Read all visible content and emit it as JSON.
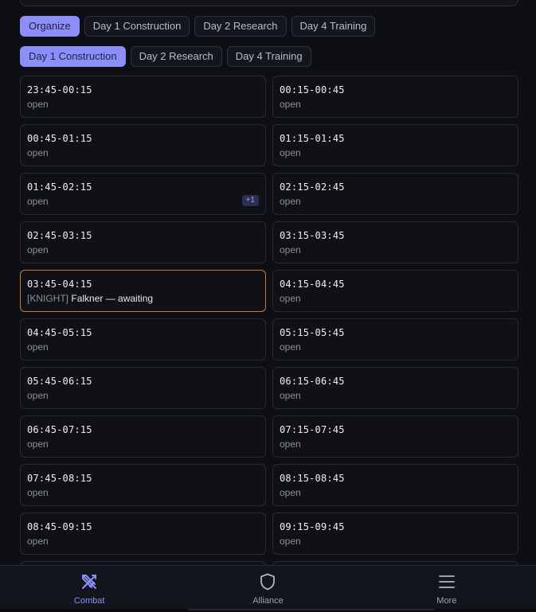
{
  "tabs_row1": [
    {
      "label": "Organize",
      "active": true
    },
    {
      "label": "Day 1 Construction",
      "active": false
    },
    {
      "label": "Day 2 Research",
      "active": false
    },
    {
      "label": "Day 4 Training",
      "active": false
    }
  ],
  "tabs_row2": [
    {
      "label": "Day 1 Construction",
      "active": true
    },
    {
      "label": "Day 2 Research",
      "active": false
    },
    {
      "label": "Day 4 Training",
      "active": false
    }
  ],
  "slots": [
    {
      "time": "23:45-00:15",
      "status": "open"
    },
    {
      "time": "00:15-00:45",
      "status": "open"
    },
    {
      "time": "00:45-01:15",
      "status": "open"
    },
    {
      "time": "01:15-01:45",
      "status": "open"
    },
    {
      "time": "01:45-02:15",
      "status": "open",
      "badge": "+1"
    },
    {
      "time": "02:15-02:45",
      "status": "open"
    },
    {
      "time": "02:45-03:15",
      "status": "open"
    },
    {
      "time": "03:15-03:45",
      "status": "open"
    },
    {
      "time": "03:45-04:15",
      "tag": "[KNIGHT]",
      "name": "Falkner — awaiting",
      "claimed": true
    },
    {
      "time": "04:15-04:45",
      "status": "open"
    },
    {
      "time": "04:45-05:15",
      "status": "open"
    },
    {
      "time": "05:15-05:45",
      "status": "open"
    },
    {
      "time": "05:45-06:15",
      "status": "open"
    },
    {
      "time": "06:15-06:45",
      "status": "open"
    },
    {
      "time": "06:45-07:15",
      "status": "open"
    },
    {
      "time": "07:15-07:45",
      "status": "open"
    },
    {
      "time": "07:45-08:15",
      "status": "open"
    },
    {
      "time": "08:15-08:45",
      "status": "open"
    },
    {
      "time": "08:45-09:15",
      "status": "open"
    },
    {
      "time": "09:15-09:45",
      "status": "open"
    }
  ],
  "nav": {
    "combat": {
      "label": "Combat",
      "icon": "crossed-swords-icon",
      "active": true
    },
    "alliance": {
      "label": "Alliance",
      "icon": "shield-icon",
      "active": false
    },
    "more": {
      "label": "More",
      "icon": "menu-icon",
      "active": false
    }
  },
  "colors": {
    "accent": "#8b8ff7",
    "claimed_border": "#c57a3f",
    "background": "#0d0f14"
  }
}
